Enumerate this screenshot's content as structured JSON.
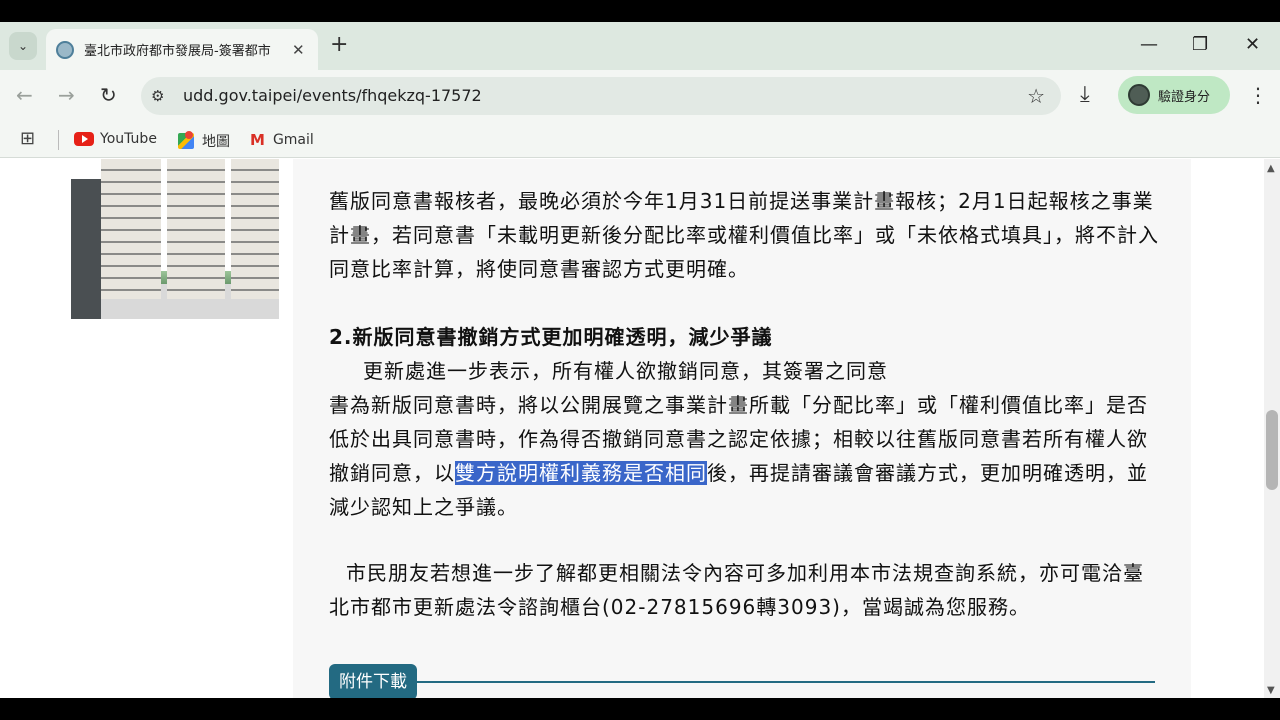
{
  "browser": {
    "tab_title": "臺北市政府都市發展局-簽署都市",
    "url": "udd.gov.taipei/events/fhqekzq-17572",
    "profile_label": "驗證身分",
    "tab_close": "✕",
    "new_tab": "+",
    "minimize": "—",
    "restore": "❐",
    "close": "✕",
    "back": "←",
    "forward": "→",
    "reload": "↻",
    "star": "☆",
    "download": "⤓",
    "menu": "⋮",
    "tab_search": "⌄",
    "apps": "⊞",
    "tune": "⚙"
  },
  "bookmarks": [
    {
      "label": "YouTube",
      "icon": "youtube-icon"
    },
    {
      "label": "地圖",
      "icon": "maps-icon"
    },
    {
      "label": "Gmail",
      "icon": "gmail-icon"
    }
  ],
  "article": {
    "para1": "舊版同意書報核者，最晚必須於今年1月31日前提送事業計畫報核；2月1日起報核之事業計畫，若同意書「未載明更新後分配比率或權利價值比率」或「未依格式填具」，將不計入同意比率計算，將使同意書審認方式更明確。",
    "heading2": "2.新版同意書撤銷方式更加明確透明，減少爭議",
    "para2_line1": "更新處進一步表示，所有權人欲撤銷同意，其簽署之同意",
    "para2_a": "書為新版同意書時，將以公開展覽之事業計畫所載「分配比率」或「權利價值比率」是否低於出具同意書時，作為得否撤銷同意書之認定依據；相較以往舊版同意書若所有權人欲撤銷同意，以",
    "para2_highlight": "雙方說明權利義務是否相同",
    "para2_b": "後，再提請審議會審議方式，更加明確透明，並減少認知上之爭議。",
    "para3": "市民朋友若想進一步了解都更相關法令內容可多加利用本市法規查詢系統，亦可電洽臺北市都市更新處法令諮詢櫃台(02-27815696轉3093)，當竭誠為您服務。",
    "attachments_label": "附件下載"
  },
  "scrollbar": {
    "up": "▲",
    "down": "▼"
  }
}
